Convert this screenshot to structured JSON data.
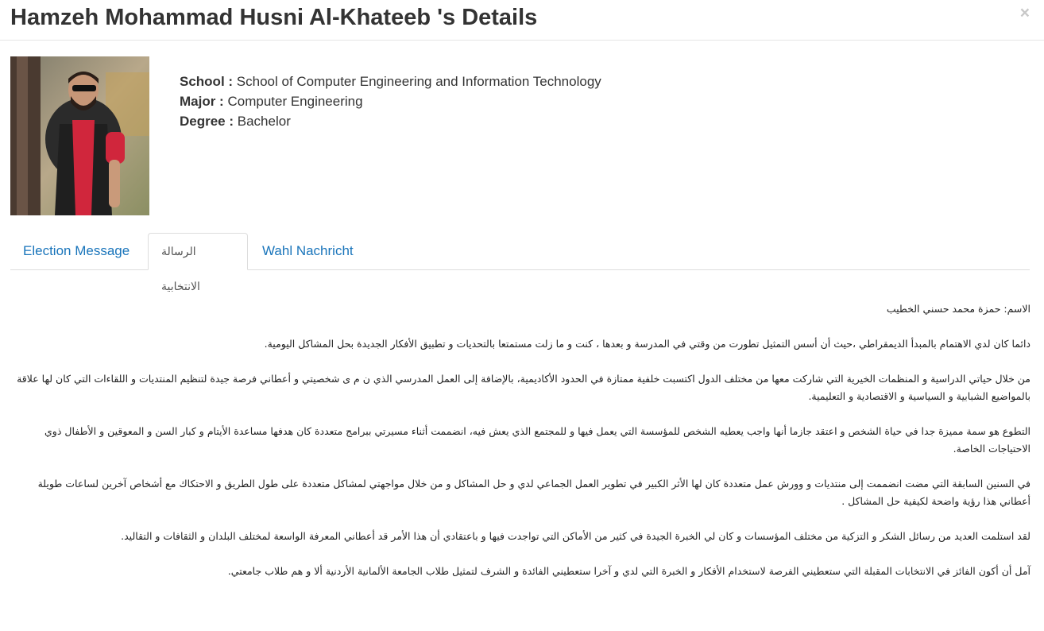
{
  "modal": {
    "title": "Hamzeh Mohammad Husni Al-Khateeb 's Details",
    "close_glyph": "×"
  },
  "photo": {
    "icon": "profile-photo"
  },
  "info": {
    "school_label": "School :",
    "school_value": "School of Computer Engineering and Information Technology",
    "major_label": "Major :",
    "major_value": "Computer Engineering",
    "degree_label": "Degree :",
    "degree_value": "Bachelor"
  },
  "tabs": [
    {
      "label": "Election Message",
      "active": false
    },
    {
      "label": "الرسالة الانتخابية",
      "active": true
    },
    {
      "label": "Wahl Nachricht",
      "active": false
    }
  ],
  "message": {
    "paragraphs": [
      "الاسم: حمزة محمد حسني الخطيب",
      "دائما كان لدي الاهتمام بالمبدأ الديمقراطي ،حيث أن أسس التمثيل تطورت من وقتي في المدرسة و بعدها ، كنت و ما زلت مستمتعا بالتحديات و تطبيق الأفكار الجديدة بحل المشاكل اليومية.",
      "من خلال حياتي الدراسية و المنظمات الخيرية التي شاركت معها من مختلف الدول اكتسبت خلفية ممتازة في الحدود الأكاديمية، بالإضافة إلى العمل المدرسي الذي ن م ى شخصيتي و أعطاني فرصة جيدة لتنظيم المنتديات و اللقاءات التي كان لها علاقة بالمواضيع الشبابية و السياسية و الاقتصادية و التعليمية.",
      "التطوع هو سمة مميزة جدا في حياة الشخص و اعتقد جازما أنها واجب يعطيه الشخص للمؤسسة التي يعمل فيها و للمجتمع الذي يعش فيه، انضممت أثناء مسيرتي ببرامج متعددة كان هدفها مساعدة الأيتام و كبار السن و المعوقين و الأطفال ذوي الاحتياجات الخاصة.",
      "في السنين السابقة التي مضت انضممت إلى منتديات و وورش عمل متعددة كان لها الأثر الكبير في تطوير العمل الجماعي لدي و حل المشاكل و من خلال مواجهتي لمشاكل متعددة على طول الطريق و الاحتكاك مع أشخاص آخرين لساعات طويلة أعطاني هذا رؤية واضحة لكيفية حل المشاكل .",
      "لقد استلمت العديد من رسائل الشكر و التزكية من مختلف المؤسسات و كان لي الخبرة الجيدة في كثير من الأماكن التي تواجدت فيها و باعتقادي أن هذا الأمر قد أعطاني المعرفة الواسعة لمختلف البلدان و الثقافات و التقاليد.",
      "آمل أن أكون الفائز في الانتخابات المقبلة التي ستعطيني الفرصة لاستخدام الأفكار و الخبرة التي لدي و آخرا ستعطيني الفائدة و الشرف لتمثيل طلاب الجامعة الألمانية الأردنية ألا و هم طلاب جامعتي."
    ]
  }
}
